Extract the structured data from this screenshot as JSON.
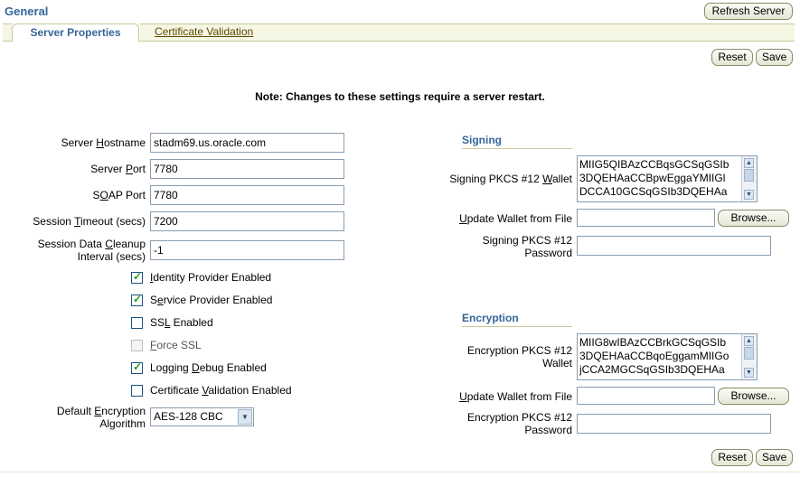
{
  "header": {
    "title": "General",
    "refresh_label": "Refresh Server"
  },
  "tabs": [
    {
      "label": "Server Properties",
      "active": true
    },
    {
      "label": "Certificate Validation",
      "active": false
    }
  ],
  "actions": {
    "reset_label": "Reset",
    "save_label": "Save"
  },
  "note": "Note: Changes to these settings require a server restart.",
  "server": {
    "hostname": {
      "label_pre": "Server ",
      "label_key": "H",
      "label_post": "ostname",
      "value": "stadm69.us.oracle.com"
    },
    "port": {
      "label_pre": "Server ",
      "label_key": "P",
      "label_post": "ort",
      "value": "7780"
    },
    "soap_port": {
      "label_pre": "S",
      "label_key": "O",
      "label_post": "AP Port",
      "value": "7780"
    },
    "timeout": {
      "label_pre": "Session ",
      "label_key": "T",
      "label_post": "imeout (secs)",
      "value": "7200"
    },
    "cleanup": {
      "label_pre": "Session Data ",
      "label_key": "C",
      "label_post": "leanup",
      "label_line2": "Interval (secs)",
      "value": "-1"
    }
  },
  "checkboxes": [
    {
      "pre": "",
      "key": "I",
      "post": "dentity Provider Enabled",
      "checked": true,
      "disabled": false
    },
    {
      "pre": "S",
      "key": "e",
      "post": "rvice Provider Enabled",
      "checked": true,
      "disabled": false
    },
    {
      "pre": "SS",
      "key": "L",
      "post": " Enabled",
      "checked": false,
      "disabled": false
    },
    {
      "pre": "",
      "key": "F",
      "post": "orce SSL",
      "checked": false,
      "disabled": true
    },
    {
      "pre": "Logging ",
      "key": "D",
      "post": "ebug Enabled",
      "checked": true,
      "disabled": false
    },
    {
      "pre": "Certificate ",
      "key": "V",
      "post": "alidation Enabled",
      "checked": false,
      "disabled": false
    }
  ],
  "algorithm": {
    "label_pre": "Default ",
    "label_key": "E",
    "label_post": "ncryption",
    "label_line2": "Algorithm",
    "value": "AES-128 CBC"
  },
  "signing": {
    "heading": "Signing",
    "wallet_label_pre": "Signing PKCS #12 ",
    "wallet_label_key": "W",
    "wallet_label_post": "allet",
    "wallet_lines": [
      "MIIG5QIBAzCCBqsGCSqGSIb",
      "3DQEHAaCCBpwEggaYMIIGl",
      "DCCA10GCSqGSIb3DQEHAa"
    ],
    "update_label_pre": "",
    "update_label_key": "U",
    "update_label_post": "pdate Wallet from File",
    "browse_label": "Browse...",
    "password_label_line1": "Signing PKCS #12",
    "password_label_line2": "Password"
  },
  "encryption": {
    "heading": "Encryption",
    "wallet_label_line1": "Encryption PKCS #12",
    "wallet_label_line2": "Wallet",
    "wallet_lines": [
      "MIIG8wIBAzCCBrkGCSqGSIb",
      "3DQEHAaCCBqoEggamMIIGo",
      "jCCA2MGCSqGSIb3DQEHAa"
    ],
    "update_label_pre": "",
    "update_label_key": "U",
    "update_label_post": "pdate Wallet from File",
    "browse_label": "Browse...",
    "password_label_line1": "Encryption PKCS #12",
    "password_label_line2": "Password"
  },
  "colors": {
    "title_blue": "#336699",
    "tab_bg": "#f6f6e4",
    "tab_border": "#c9c89b",
    "check_green": "#21a121"
  }
}
